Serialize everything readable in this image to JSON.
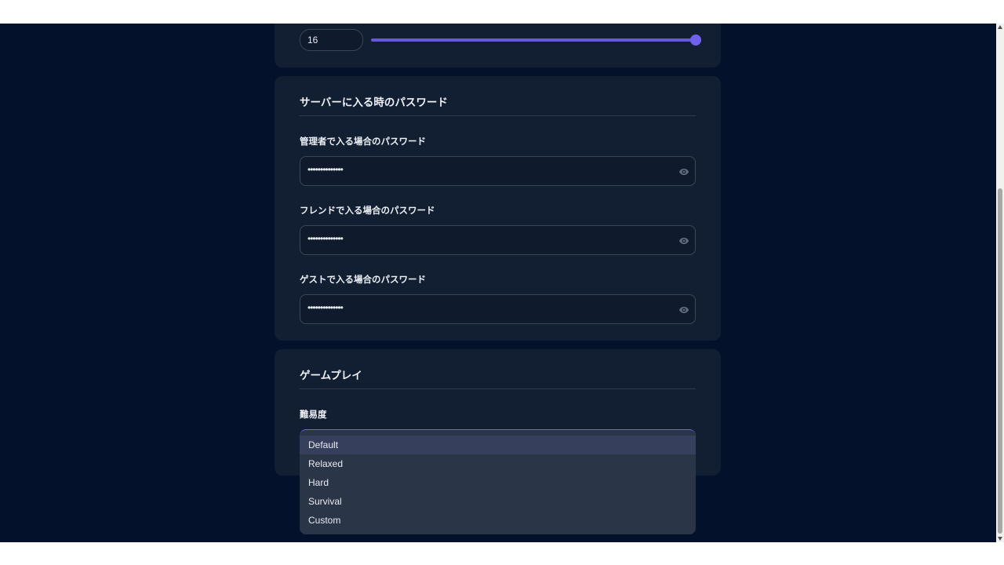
{
  "top_setting": {
    "value": "16",
    "slider_level_percent": 100
  },
  "passwords": {
    "section_title": "サーバーに入る時のパスワード",
    "admin": {
      "label": "管理者で入る場合のパスワード",
      "masked_value": "••••••••••••••"
    },
    "friend": {
      "label": "フレンドで入る場合のパスワード",
      "masked_value": "••••••••••••••"
    },
    "guest": {
      "label": "ゲストで入る場合のパスワード",
      "masked_value": "••••••••••••••"
    }
  },
  "gameplay": {
    "section_title": "ゲームプレイ",
    "difficulty": {
      "label": "難易度",
      "selected": "Default",
      "options": [
        "Default",
        "Relaxed",
        "Hard",
        "Survival",
        "Custom"
      ]
    }
  },
  "colors": {
    "accent": "#6f61ec",
    "background": "#03112b",
    "card": "#121e31"
  }
}
